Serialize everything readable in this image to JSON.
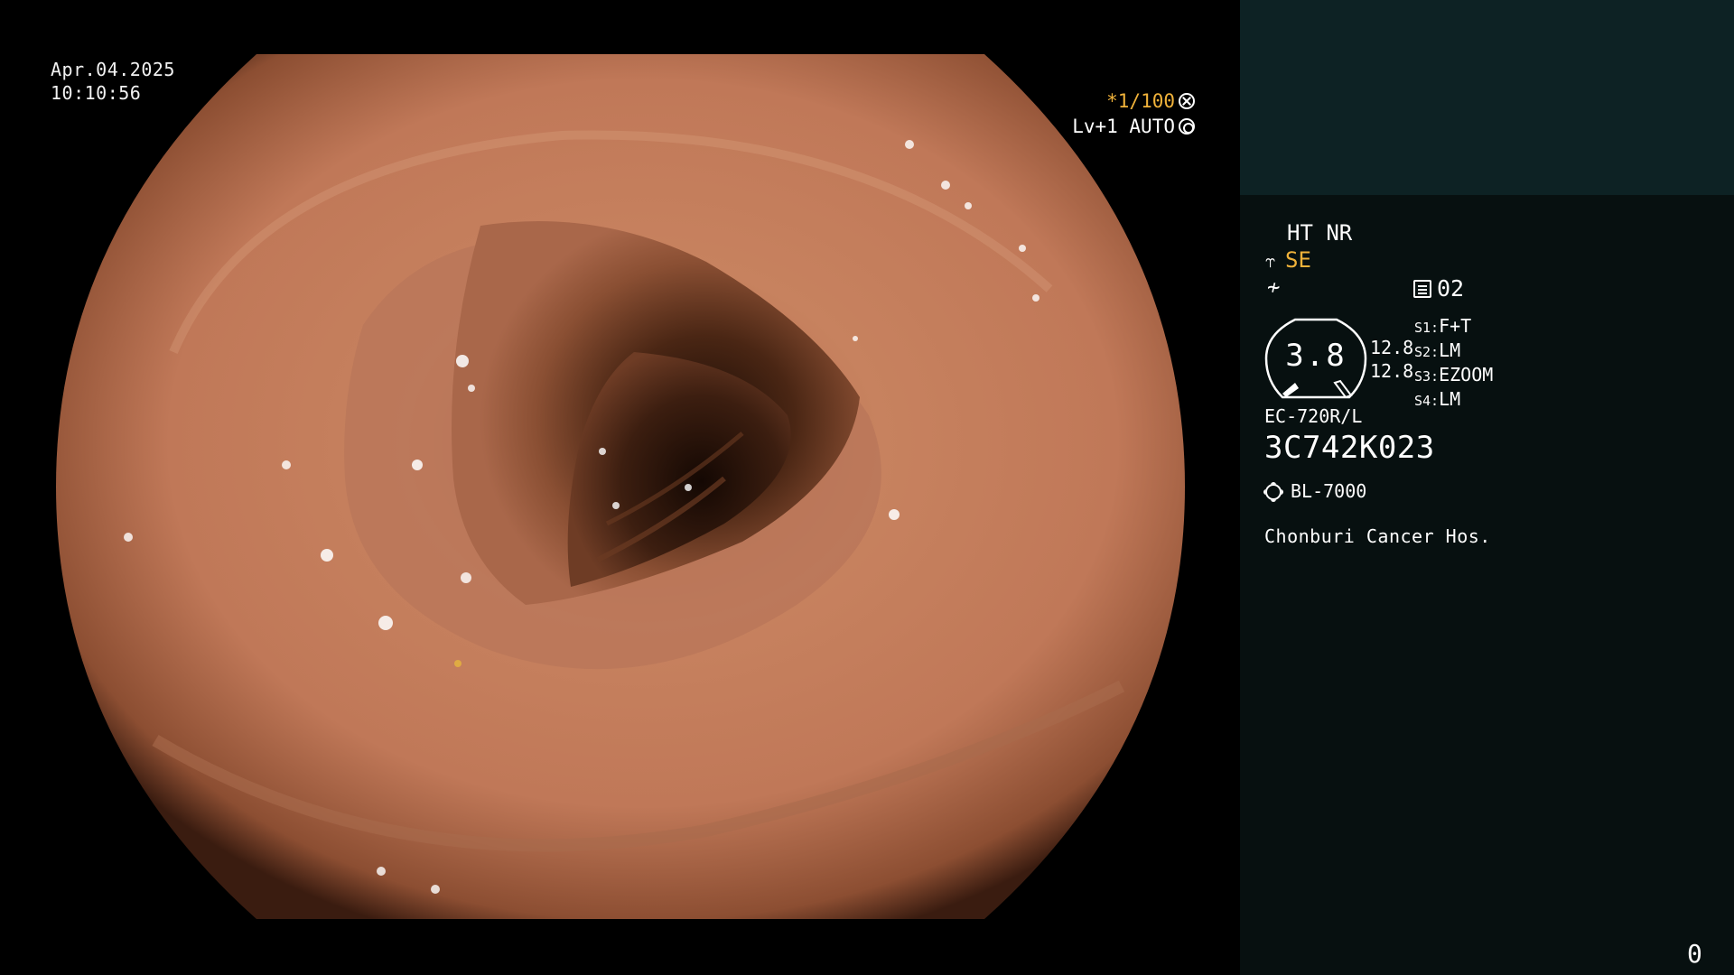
{
  "overlay": {
    "date": "Apr.04.2025",
    "time": "10:10:56",
    "shutter": "*1/100",
    "level": "Lv+1 AUTO"
  },
  "info_panel": {
    "ht_nr": "HT NR",
    "se": "SE",
    "memory": "02",
    "gauge_value": "3.8",
    "pressure_1": "12.8",
    "pressure_2": "12.8",
    "modes": [
      {
        "key": "S1:",
        "value": "F+T"
      },
      {
        "key": "S2:",
        "value": "LM"
      },
      {
        "key": "S3:",
        "value": "EZOOM"
      },
      {
        "key": "S4:",
        "value": "LM"
      }
    ],
    "scope_model": "EC-720R/L",
    "scope_serial": "3C742K023",
    "light_source": "BL-7000",
    "hospital": "Chonburi Cancer Hos.",
    "counter": "0"
  },
  "icons": {
    "shutter_icon": "asterisk-circle-icon",
    "level_icon": "gear-circle-icon",
    "se_icon": "structure-enhance-icon",
    "enh_icon": "color-enhance-icon",
    "memory_icon": "memory-card-icon",
    "light_icon": "sun-icon"
  },
  "colors": {
    "accent": "#f0b23a",
    "panel_top": "#0d2224",
    "panel_bg": "#071010",
    "tissue": "#c98361",
    "lumen": "#2a150c"
  }
}
